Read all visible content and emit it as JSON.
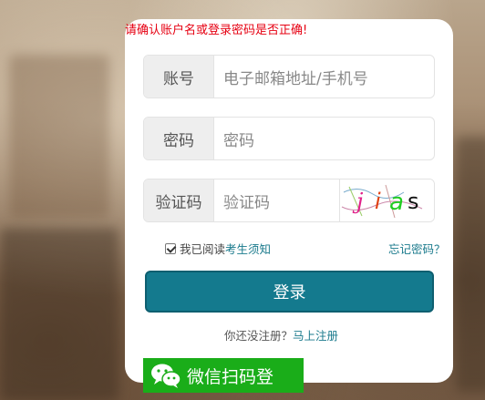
{
  "error": {
    "message": "请确认账户名或登录密码是否正确!"
  },
  "form": {
    "account": {
      "label": "账号",
      "placeholder": "电子邮箱地址/手机号"
    },
    "password": {
      "label": "密码",
      "placeholder": "密码"
    },
    "captcha": {
      "label": "验证码",
      "placeholder": "验证码",
      "image_text": "jias"
    }
  },
  "agreement": {
    "prefix": "我已阅读",
    "link": "考生须知",
    "checked": true
  },
  "forgot_password": "忘记密码？",
  "login_button": "登录",
  "register": {
    "prompt": "你还没注册？",
    "link": "马上注册"
  },
  "wechat_login": {
    "label": "微信扫码登",
    "icon": "wechat-icon"
  },
  "colors": {
    "primary": "#147a8e",
    "error": "#e60012",
    "wechat": "#1aad19",
    "link": "#1a7a8c"
  }
}
